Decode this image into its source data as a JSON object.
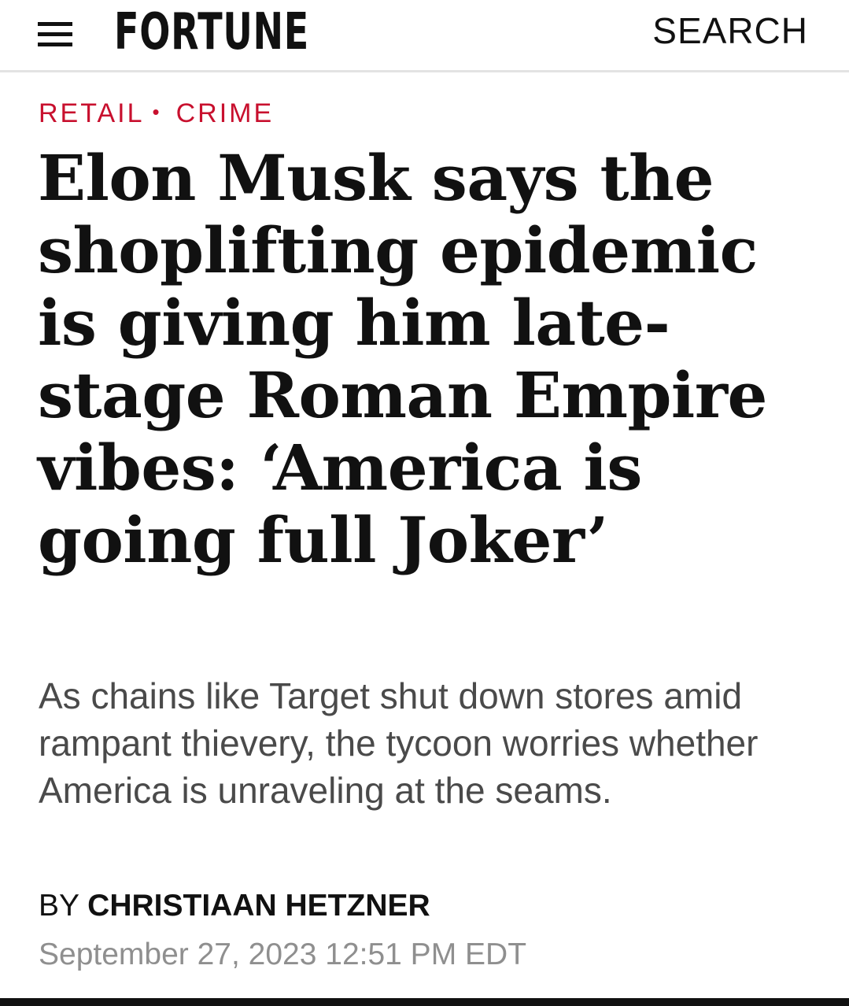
{
  "header": {
    "logo": "FORTUNE",
    "search_label": "SEARCH",
    "menu_icon": "hamburger-menu-icon"
  },
  "article": {
    "tags": [
      "RETAIL",
      "CRIME"
    ],
    "tag_separator": "•",
    "headline": "Elon Musk says the shoplifting epidemic is giving him late-stage Roman Empire vibes: ‘America is going full Joker’",
    "dek": "As chains like Target shut down stores amid rampant thievery, the tycoon worries whether America is unraveling at the seams.",
    "byline_prefix": "BY",
    "author": "CHRISTIAAN HETZNER",
    "date": "September 27, 2023 12:51 PM EDT"
  },
  "colors": {
    "accent": "#c8102e",
    "text": "#111111",
    "dek": "#4a4a4a",
    "date": "#8f8f8f"
  }
}
